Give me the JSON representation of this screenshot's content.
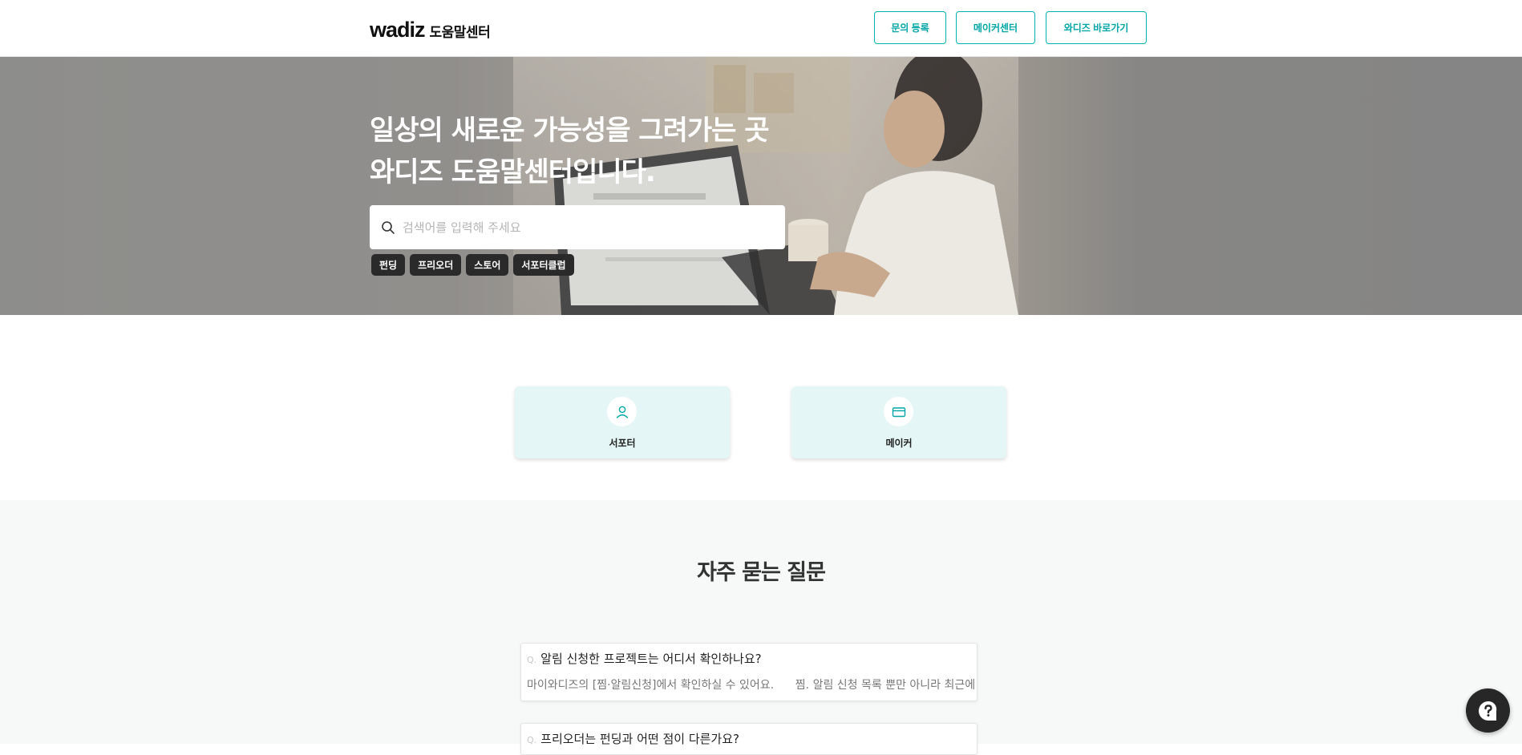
{
  "header": {
    "logo_word": "wadiz",
    "logo_sub": "도움말센터",
    "buttons": [
      "문의 등록",
      "메이커센터",
      "와디즈 바로가기"
    ]
  },
  "hero": {
    "title_line1": "일상의 새로운 가능성을 그려가는 곳",
    "title_line2": "와디즈 도움말센터입니다.",
    "search_placeholder": "검색어를 입력해 주세요",
    "tags": [
      "펀딩",
      "프리오더",
      "스토어",
      "서포터클럽"
    ]
  },
  "categories": [
    {
      "label": "서포터",
      "icon": "person-icon"
    },
    {
      "label": "메이커",
      "icon": "card-icon"
    }
  ],
  "faq": {
    "title": "자주 묻는 질문",
    "q_mark": "Q.",
    "items": [
      {
        "question": "알림 신청한 프로젝트는 어디서 확인하나요?",
        "answer": "마이와디즈의 [찜·알림신청]에서 확인하실 수 있어요.      찜. 알림 신청 목록 뿐만 아니라 최근에 본"
      },
      {
        "question": "프리오더는 펀딩과 어떤 점이 다른가요?",
        "answer": ""
      }
    ]
  },
  "colors": {
    "accent": "#00b2b2",
    "card_bg": "#e5f6f6",
    "tag_bg": "#2a2a2a",
    "fab_bg": "#272727"
  }
}
